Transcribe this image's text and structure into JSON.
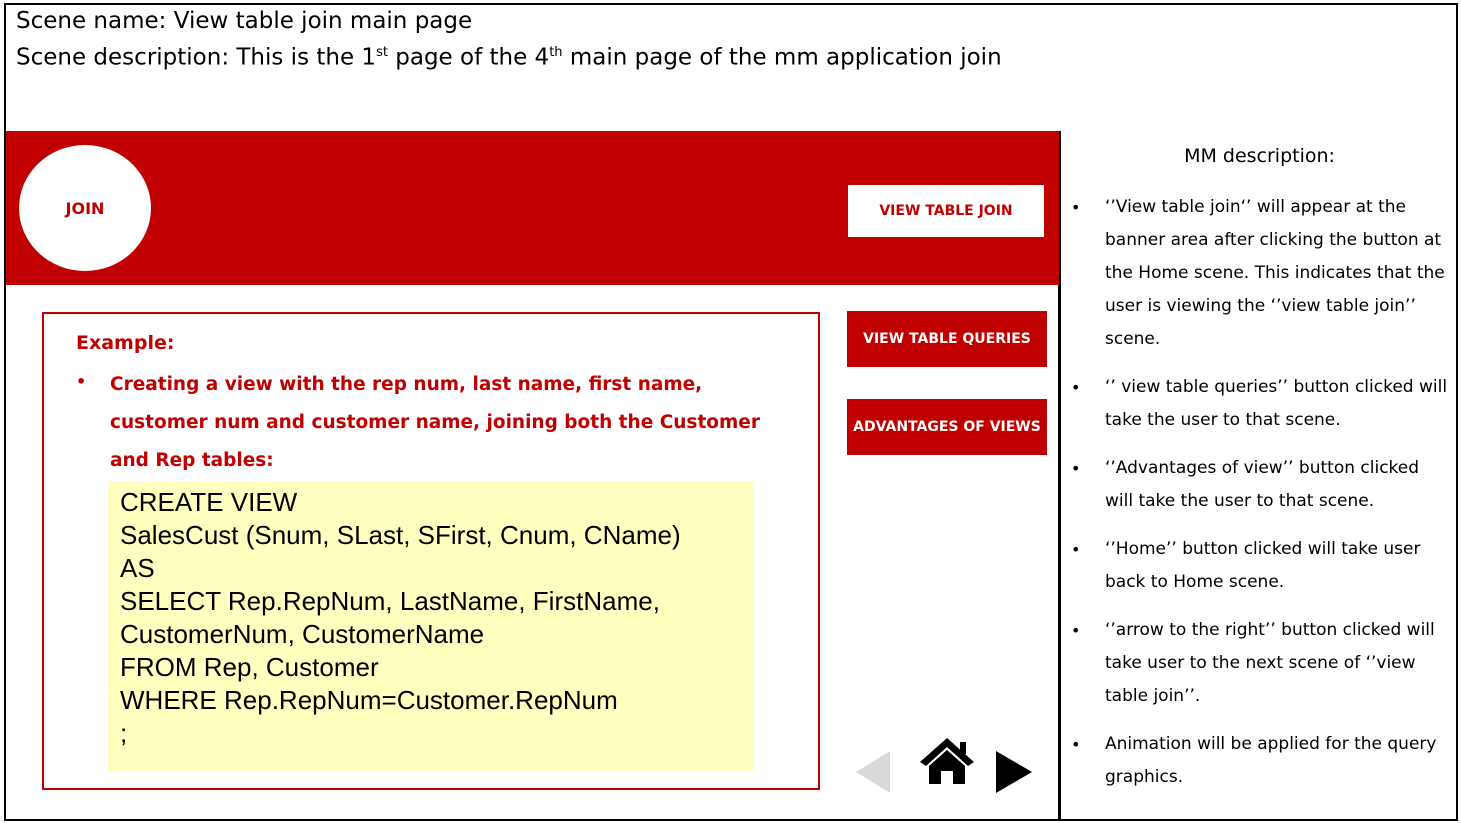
{
  "header": {
    "line1": "Scene name: View table join main page",
    "line2_a": "Scene description: This is the 1",
    "line2_sup1": "st",
    "line2_b": " page of the 4",
    "line2_sup2": "th",
    "line2_c": " main page of the mm application join"
  },
  "banner": {
    "circle_label": "JOIN",
    "button_label": "VIEW TABLE JOIN"
  },
  "example": {
    "title": "Example:",
    "bullet": "•",
    "text": "Creating a view with the rep num, last name, first name, customer num and customer name, joining both the Customer and Rep tables:",
    "code": "CREATE VIEW\nSalesCust (Snum, SLast, SFirst, Cnum, CName)\nAS\nSELECT Rep.RepNum, LastName, FirstName,\nCustomerNum, CustomerName\nFROM Rep, Customer\nWHERE Rep.RepNum=Customer.RepNum\n;"
  },
  "side_buttons": {
    "queries": "VIEW TABLE  QUERIES",
    "advantages": "ADVANTAGES OF VIEWS"
  },
  "nav": {
    "left_icon": "arrow-left-icon",
    "home_icon": "home-icon",
    "right_icon": "arrow-right-icon"
  },
  "description": {
    "title": "MM description:",
    "items": [
      "‘’View table join‘’ will appear at the banner area after clicking the button at the  Home scene. This indicates that the user is viewing the ‘’view table join’’ scene.",
      "‘’ view table queries’’ button clicked will take the user to that scene.",
      "‘’Advantages of view’’ button clicked will take the user to that scene.",
      "‘’Home’’ button clicked will take user back to Home scene.",
      "‘’arrow to the right’’ button clicked will take user to the next scene of ‘’view table join’’.",
      "Animation will be applied for the query graphics."
    ]
  },
  "colors": {
    "accent_red": "#c00000",
    "code_bg": "#ffffc0",
    "disabled_gray": "#d9d9d9"
  }
}
